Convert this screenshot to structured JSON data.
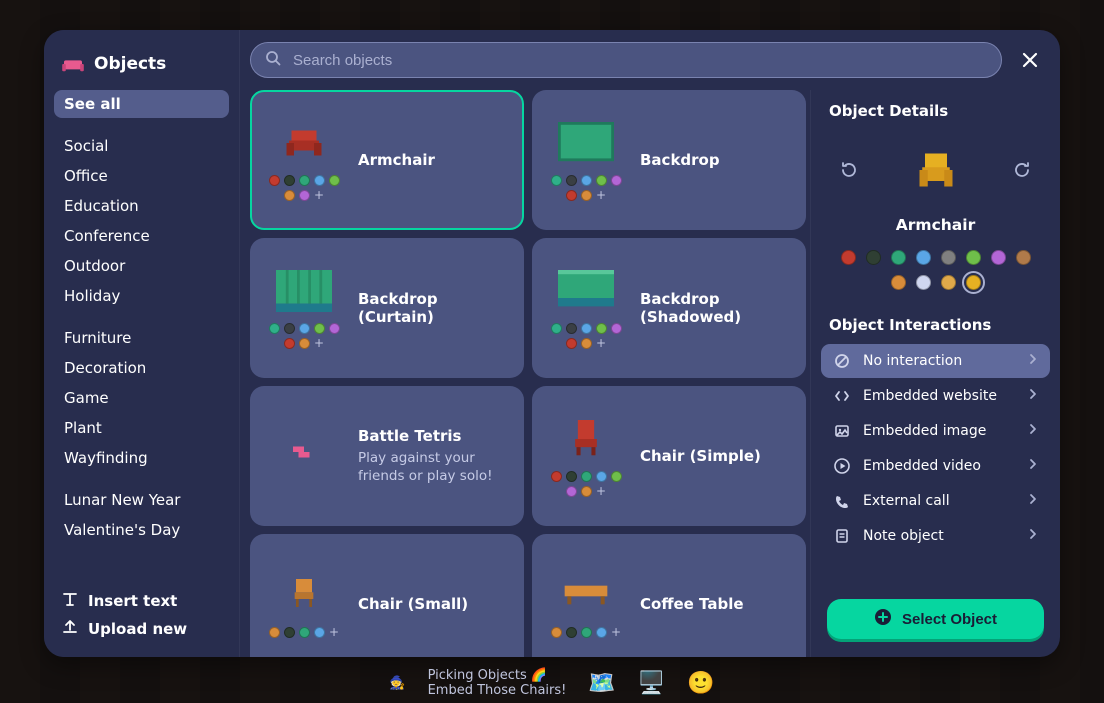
{
  "header": {
    "title": "Objects"
  },
  "search": {
    "placeholder": "Search objects"
  },
  "categories": {
    "see_all": {
      "label": "See all"
    },
    "group1": [
      {
        "label": "Social"
      },
      {
        "label": "Office"
      },
      {
        "label": "Education"
      },
      {
        "label": "Conference"
      },
      {
        "label": "Outdoor"
      },
      {
        "label": "Holiday"
      }
    ],
    "group2": [
      {
        "label": "Furniture"
      },
      {
        "label": "Decoration"
      },
      {
        "label": "Game"
      },
      {
        "label": "Plant"
      },
      {
        "label": "Wayfinding"
      }
    ],
    "group3": [
      {
        "label": "Lunar New Year"
      },
      {
        "label": "Valentine's Day"
      }
    ]
  },
  "sidebar_footer": {
    "insert_text": "Insert text",
    "upload_new": "Upload new"
  },
  "items": [
    {
      "name": "Armchair",
      "selected": true,
      "swatches": [
        "#c33b2e",
        "#2f3f33",
        "#2fa779",
        "#5aa6e6",
        "#6fbf4a",
        "#d88c3a",
        "#b366d6"
      ]
    },
    {
      "name": "Backdrop",
      "swatches": [
        "#2fb089",
        "#3a3f44",
        "#5aa6e6",
        "#6fbf4a",
        "#b366d6",
        "#c33b2e",
        "#d88c3a"
      ]
    },
    {
      "name": "Backdrop (Curtain)",
      "swatches": [
        "#2fb089",
        "#3a3f44",
        "#5aa6e6",
        "#6fbf4a",
        "#b366d6",
        "#c33b2e",
        "#d88c3a"
      ]
    },
    {
      "name": "Backdrop (Shadowed)",
      "swatches": [
        "#2fb089",
        "#3a3f44",
        "#5aa6e6",
        "#6fbf4a",
        "#b366d6",
        "#c33b2e",
        "#d88c3a"
      ]
    },
    {
      "name": "Battle Tetris",
      "desc": "Play against your friends or play solo!",
      "swatches": []
    },
    {
      "name": "Chair (Simple)",
      "swatches": [
        "#c33b2e",
        "#2f3f33",
        "#2fa779",
        "#5aa6e6",
        "#6fbf4a",
        "#b366d6",
        "#d88c3a"
      ]
    },
    {
      "name": "Chair (Small)",
      "swatches": [
        "#d88c3a",
        "#2f3f33",
        "#2fa779",
        "#5aa6e6"
      ]
    },
    {
      "name": "Coffee Table",
      "swatches": [
        "#d88c3a",
        "#2f3f33",
        "#2fa779",
        "#5aa6e6"
      ]
    }
  ],
  "details": {
    "panel_title": "Object Details",
    "name": "Armchair",
    "swatches": [
      "#c33b2e",
      "#2f3f33",
      "#2fa779",
      "#5aa6e6",
      "#808080",
      "#6fbf4a",
      "#b366d6",
      "#b07a4a",
      "#d88c3a",
      "#cfd6f0",
      "#e0a94a",
      "#e6b022"
    ],
    "selected_swatch_index": 11,
    "interactions_title": "Object Interactions",
    "interactions": [
      {
        "label": "No interaction",
        "icon": "ban",
        "active": true
      },
      {
        "label": "Embedded website",
        "icon": "code"
      },
      {
        "label": "Embedded image",
        "icon": "image"
      },
      {
        "label": "Embedded video",
        "icon": "play"
      },
      {
        "label": "External call",
        "icon": "phone"
      },
      {
        "label": "Note object",
        "icon": "note"
      }
    ],
    "select_button": "Select Object"
  },
  "bottom": {
    "line1": "Picking Objects 🌈",
    "line2": "Embed Those Chairs!"
  }
}
